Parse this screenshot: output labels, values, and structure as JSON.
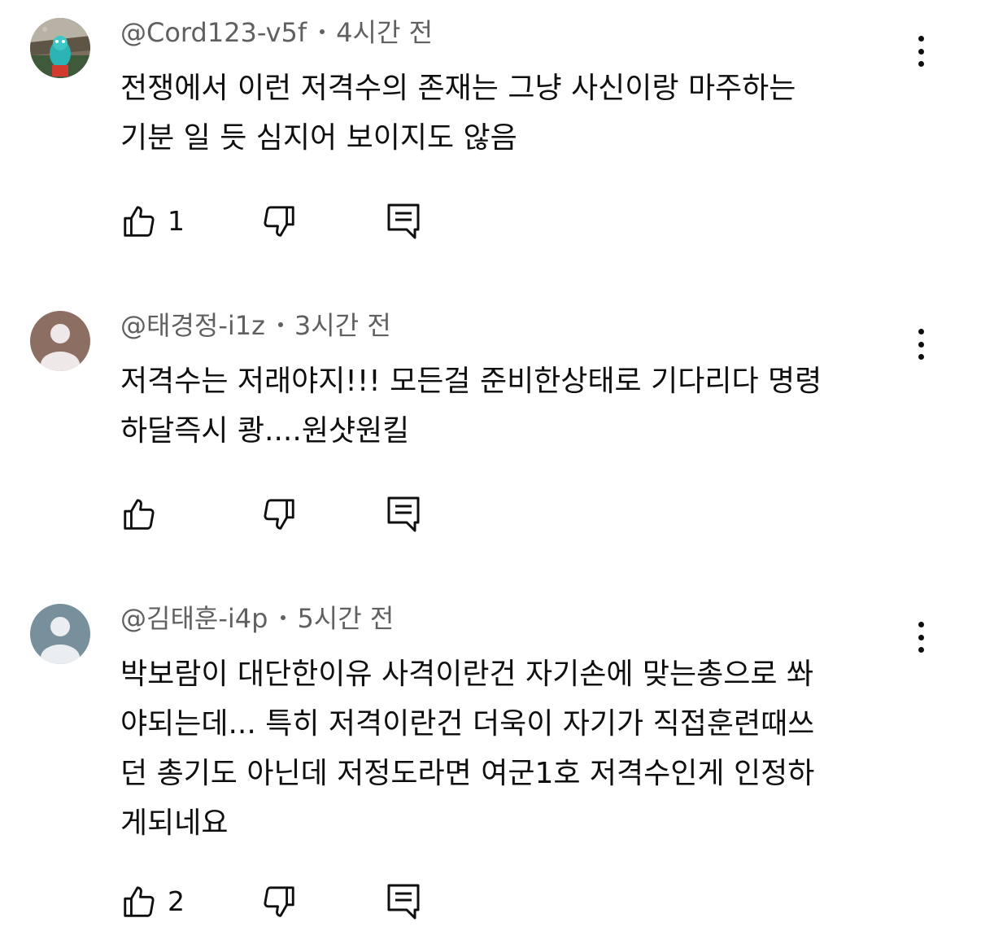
{
  "comments": [
    {
      "author": "@Cord123-v5f",
      "time": "4시간 전",
      "lines": [
        "전쟁에서 이런 저격수의 존재는 그냥 사신이랑 마주하는",
        "기분 일 듯 심지어 보이지도 않음"
      ],
      "likes": "1",
      "avatar": "custom-image"
    },
    {
      "author": "@태경정-i1z",
      "time": "3시간 전",
      "lines": [
        "저격수는 저래야지!!!  모든걸 준비한상태로 기다리다 명령",
        "하달즉시 쾅....원샷원킬"
      ],
      "likes": "",
      "avatar": "default",
      "avatar_color": "#8d6e63"
    },
    {
      "author": "@김태훈-i4p",
      "time": "5시간 전",
      "lines": [
        "박보람이 대단한이유 사격이란건 자기손에 맞는총으로 쏴",
        "야되는데... 특히 저격이란건 더욱이 자기가 직접훈련때쓰",
        "던 총기도 아닌데 저정도라면 여군1호 저격수인게 인정하",
        "게되네요"
      ],
      "likes": "2",
      "avatar": "default",
      "avatar_color": "#78909c"
    }
  ],
  "icons": {
    "like": "thumb-up-icon",
    "dislike": "thumb-down-icon",
    "reply": "reply-comment-icon",
    "menu": "more-vertical-icon"
  },
  "colors": {
    "text": "#0f0f0f",
    "secondary": "#606060",
    "background": "#ffffff"
  }
}
